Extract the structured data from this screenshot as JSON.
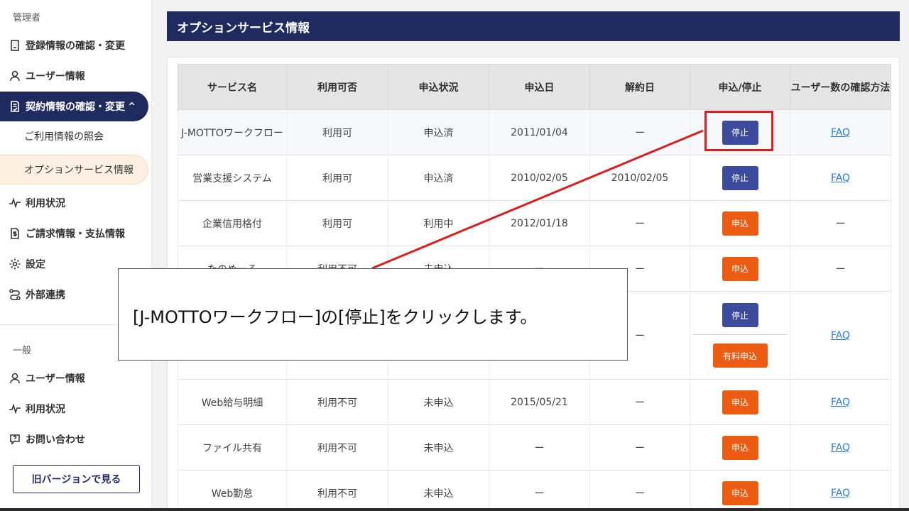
{
  "sidebar": {
    "admin_label": "管理者",
    "general_label": "一般",
    "admin_items": [
      {
        "label": "登録情報の確認・変更",
        "icon": "building-icon"
      },
      {
        "label": "ユーザー情報",
        "icon": "user-icon"
      },
      {
        "label": "契約情報の確認・変更",
        "icon": "contract-doc-icon",
        "expanded": true
      },
      {
        "label": "利用状況",
        "icon": "activity-icon"
      },
      {
        "label": "ご請求情報・支払情報",
        "icon": "invoice-icon"
      },
      {
        "label": "設定",
        "icon": "gear-icon"
      },
      {
        "label": "外部連携",
        "icon": "link-icon"
      }
    ],
    "sub_items": [
      {
        "label": "ご利用情報の照会"
      },
      {
        "label": "オプションサービス情報",
        "current": true
      }
    ],
    "general_items": [
      {
        "label": "ユーザー情報",
        "icon": "user-icon"
      },
      {
        "label": "利用状況",
        "icon": "activity-icon"
      },
      {
        "label": "お問い合わせ",
        "icon": "help-icon"
      }
    ],
    "expand_glyph": "^",
    "old_version_button": "旧バージョンで見る"
  },
  "page_title": "オプションサービス情報",
  "table": {
    "headers": [
      "サービス名",
      "利用可否",
      "申込状況",
      "申込日",
      "解約日",
      "申込/停止",
      "ユーザー数の確認方法"
    ],
    "rows": [
      {
        "name": "J-MOTTOワークフロー",
        "availability": "利用可",
        "available": true,
        "status": "申込済",
        "applied": "2011/01/04",
        "cancelled": "ー",
        "action": "停止",
        "action2": "",
        "howto": "FAQ"
      },
      {
        "name": "営業支援システム",
        "availability": "利用可",
        "available": true,
        "status": "申込済",
        "applied": "2010/02/05",
        "cancelled": "2010/02/05",
        "action": "停止",
        "action2": "",
        "howto": "FAQ"
      },
      {
        "name": "企業信用格付",
        "availability": "利用可",
        "available": true,
        "status": "利用中",
        "applied": "2012/01/18",
        "cancelled": "ー",
        "action": "申込",
        "action2": "",
        "howto": "ー"
      },
      {
        "name": "たのめーる",
        "availability": "利用不可",
        "available": false,
        "status": "未申込",
        "applied": "ー",
        "cancelled": "ー",
        "action": "申込",
        "action2": "",
        "howto": "ー"
      },
      {
        "name": "",
        "availability": "",
        "available": false,
        "status": "",
        "applied": "",
        "cancelled": "ー",
        "action": "停止",
        "action2": "有料申込",
        "howto": "FAQ"
      },
      {
        "name": "Web給与明細",
        "availability": "利用不可",
        "available": false,
        "status": "未申込",
        "applied": "2015/05/21",
        "cancelled": "ー",
        "action": "申込",
        "action2": "",
        "howto": "FAQ"
      },
      {
        "name": "ファイル共有",
        "availability": "利用不可",
        "available": false,
        "status": "未申込",
        "applied": "ー",
        "cancelled": "ー",
        "action": "申込",
        "action2": "",
        "howto": "FAQ"
      },
      {
        "name": "Web勤怠",
        "availability": "利用不可",
        "available": false,
        "status": "未申込",
        "applied": "ー",
        "cancelled": "ー",
        "action": "申込",
        "action2": "",
        "howto": "FAQ"
      }
    ]
  },
  "callout": {
    "text": "[J-MOTTOワークフロー]の[停止]をクリックします。"
  },
  "colors": {
    "navy": "#1f2a5e",
    "stop_button": "#3c4b9c",
    "apply_button": "#ec5c12",
    "available_text": "#e0453c",
    "unavailable_text": "#3f56a8",
    "annotation_red": "#d91e1e"
  }
}
